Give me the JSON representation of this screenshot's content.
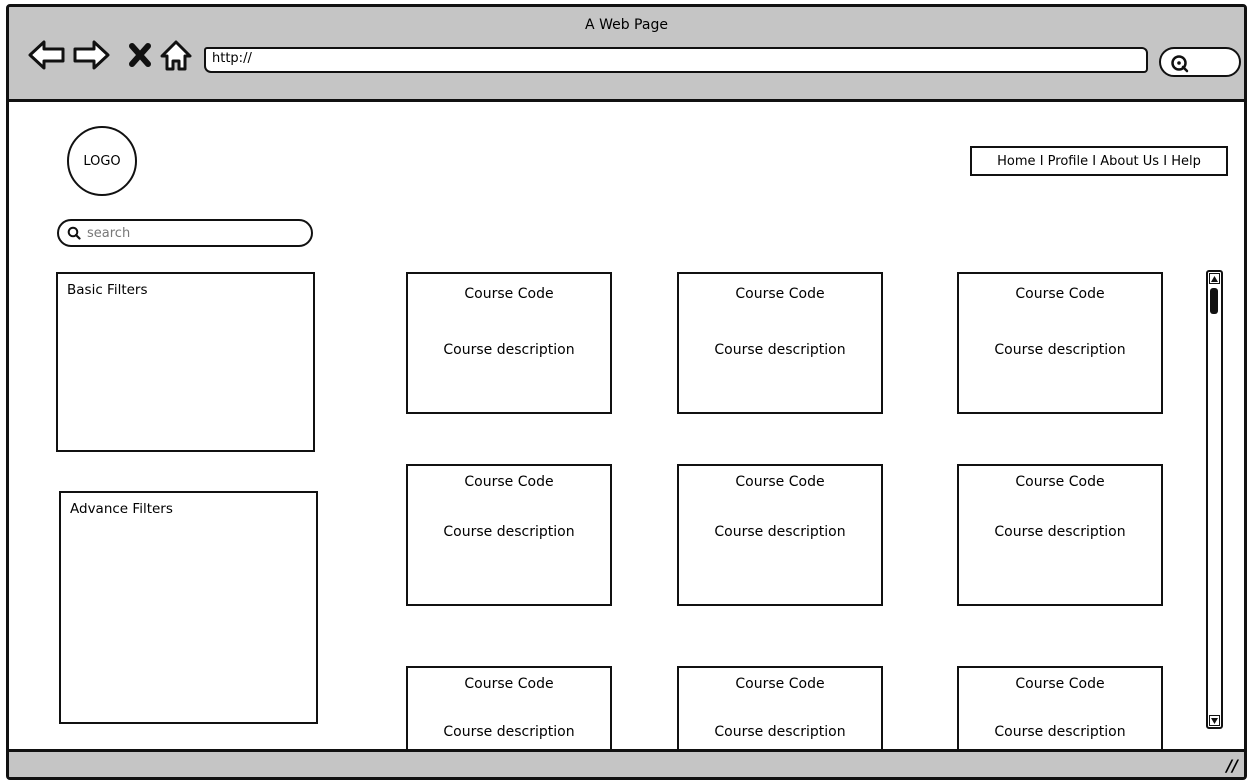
{
  "window": {
    "title": "A Web Page"
  },
  "toolbar": {
    "back_icon": "arrow-left-icon",
    "forward_icon": "arrow-right-icon",
    "stop_icon": "close-icon",
    "home_icon": "home-icon",
    "url_value": "http://",
    "search_icon": "search-icon"
  },
  "header": {
    "logo": "LOGO",
    "nav": {
      "home": "Home",
      "profile": "Profile",
      "about": "About Us",
      "help": "Help",
      "separator": "I"
    }
  },
  "search": {
    "placeholder": "search"
  },
  "filters": {
    "basic": {
      "title": "Basic Filters"
    },
    "advanced": {
      "title": "Advance Filters"
    }
  },
  "courses": [
    {
      "code": "Course Code",
      "description": "Course description"
    },
    {
      "code": "Course Code",
      "description": "Course description"
    },
    {
      "code": "Course Code",
      "description": "Course description"
    },
    {
      "code": "Course Code",
      "description": "Course description"
    },
    {
      "code": "Course Code",
      "description": "Course description"
    },
    {
      "code": "Course Code",
      "description": "Course description"
    },
    {
      "code": "Course Code",
      "description": "Course description"
    },
    {
      "code": "Course Code",
      "description": "Course description"
    },
    {
      "code": "Course Code",
      "description": "Course description"
    }
  ]
}
